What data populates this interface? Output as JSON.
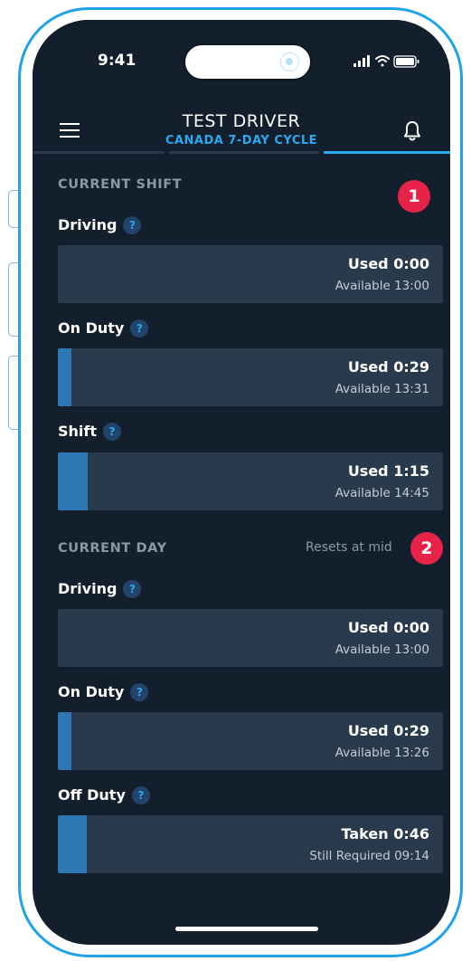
{
  "status_bar": {
    "time": "9:41"
  },
  "header": {
    "title": "TEST DRIVER",
    "subtitle": "CANADA 7-DAY CYCLE"
  },
  "current_shift": {
    "label": "CURRENT SHIFT",
    "rows": [
      {
        "label": "Driving",
        "used": "Used 0:00",
        "available": "Available 13:00",
        "progress": 0
      },
      {
        "label": "On Duty",
        "used": "Used 0:29",
        "available": "Available 13:31",
        "progress": 0.035
      },
      {
        "label": "Shift",
        "used": "Used 1:15",
        "available": "Available 14:45",
        "progress": 0.078
      }
    ]
  },
  "current_day": {
    "label": "CURRENT DAY",
    "note": "Resets at mid",
    "rows": [
      {
        "label": "Driving",
        "used": "Used 0:00",
        "available": "Available 13:00",
        "progress": 0
      },
      {
        "label": "On Duty",
        "used": "Used 0:29",
        "available": "Available 13:26",
        "progress": 0.035
      },
      {
        "label": "Off Duty",
        "used": "Taken 0:46",
        "available": "Still Required 09:14",
        "progress": 0.076
      }
    ]
  },
  "help_glyph": "?",
  "callouts": [
    "1",
    "2"
  ],
  "colors": {
    "accent": "#2aa9ee",
    "bar_fill": "#2c77b4",
    "callout": "#e8234a",
    "background": "#131f2d"
  }
}
